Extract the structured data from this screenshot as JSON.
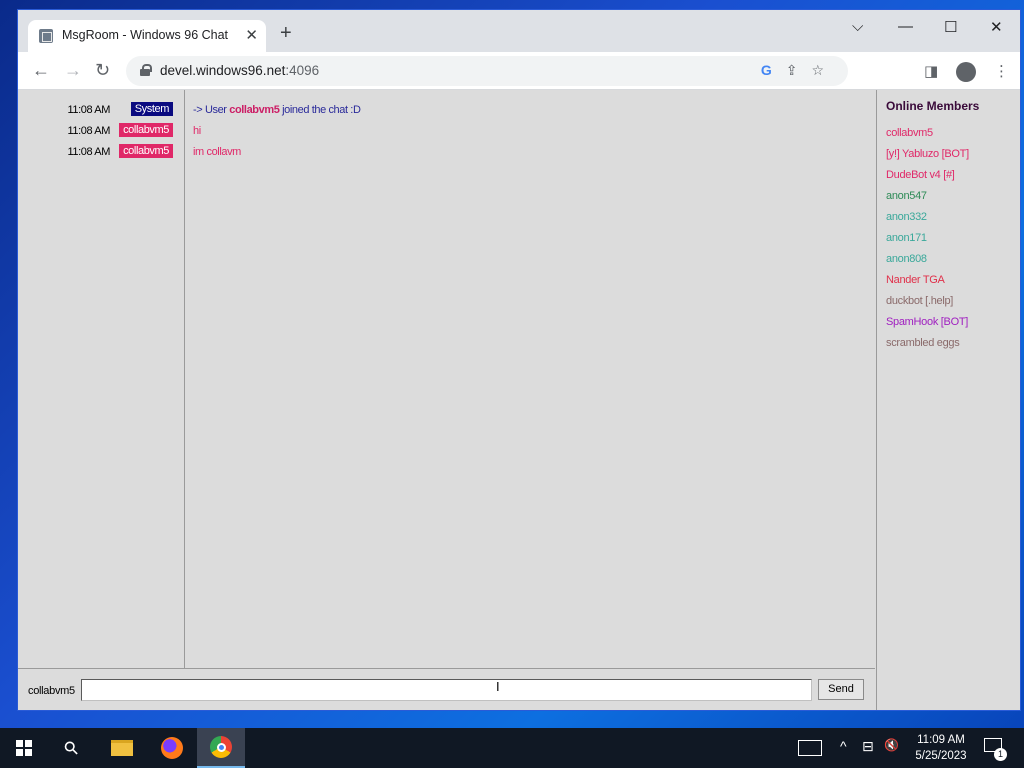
{
  "browser": {
    "tab_title": "MsgRoom - Windows 96 Chat",
    "tab_close": "✕",
    "new_tab": "+",
    "url_host": "devel.windows96.net",
    "url_port": ":4096",
    "window_controls": {
      "dropdown": "⌵",
      "minimize": "—",
      "maximize": "☐",
      "close": "✕"
    },
    "nav": {
      "back": "←",
      "forward": "→",
      "reload": "↻"
    },
    "omni_icons": {
      "google": "G",
      "share": "⇪",
      "star": "☆"
    },
    "sidepanel": "◨",
    "menu": "⋮"
  },
  "chat": {
    "messages": [
      {
        "time": "11:08 AM",
        "nick": "System",
        "text_prefix": "-> User ",
        "text_bold": "collabvm5",
        "text_suffix": " joined the chat :D"
      },
      {
        "time": "11:08 AM",
        "nick": "collabvm5",
        "text": "hi"
      },
      {
        "time": "11:08 AM",
        "nick": "collabvm5",
        "text": "im collavm"
      }
    ],
    "input_nick": "collabvm5",
    "input_value": "",
    "send_label": "Send",
    "cursor": "I"
  },
  "members": {
    "title": "Online Members",
    "list": [
      {
        "name": "collabvm5",
        "color": "#e02868"
      },
      {
        "name": "[y!] Yabluzo [BOT]",
        "color": "#e02868"
      },
      {
        "name": "DudeBot v4 [#]",
        "color": "#e02868"
      },
      {
        "name": "anon547",
        "color": "#2e8b57"
      },
      {
        "name": "anon332",
        "color": "#3aa89a"
      },
      {
        "name": "anon171",
        "color": "#3aa89a"
      },
      {
        "name": "anon808",
        "color": "#3aa89a"
      },
      {
        "name": "Nander TGA",
        "color": "#e0304a"
      },
      {
        "name": "duckbot [.help]",
        "color": "#8a6a6a"
      },
      {
        "name": "SpamHook [BOT]",
        "color": "#a020c0"
      },
      {
        "name": "scrambled eggs",
        "color": "#8a6a6a"
      }
    ]
  },
  "taskbar": {
    "clock_time": "11:09 AM",
    "clock_date": "5/25/2023",
    "notification_count": "1",
    "search_glyph": "⚲",
    "tray_chevron": "^",
    "tray_network": "⊟",
    "tray_volume": "🔇"
  }
}
